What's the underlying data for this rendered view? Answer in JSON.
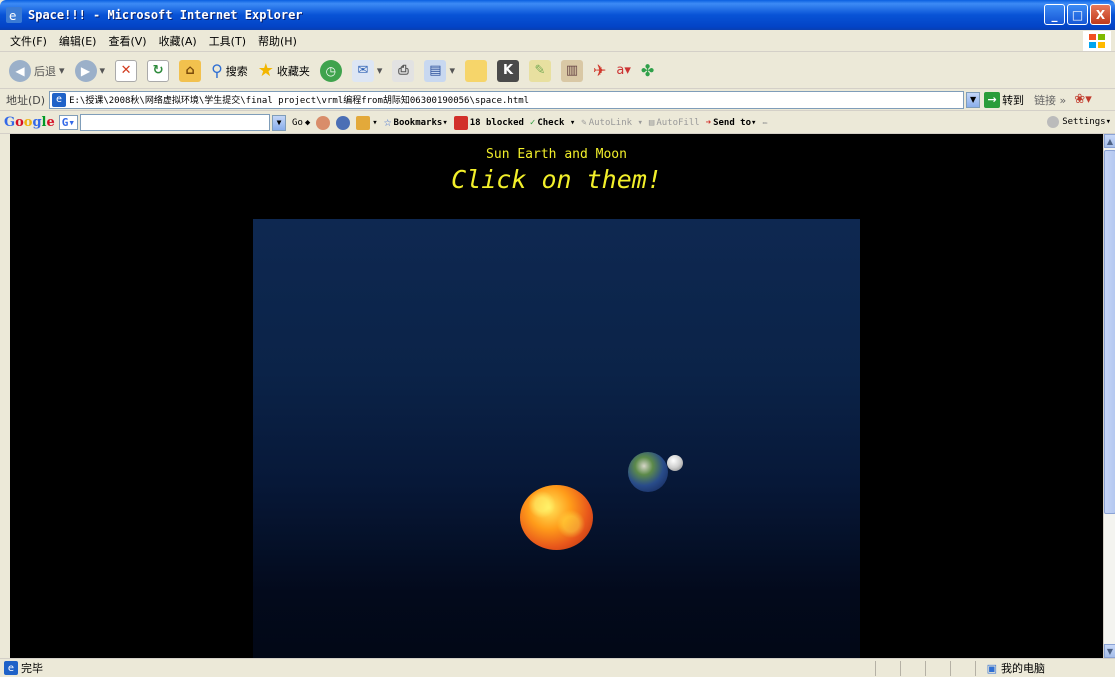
{
  "window": {
    "title": "Space!!! - Microsoft Internet Explorer",
    "buttons": [
      "_",
      "□",
      "X"
    ]
  },
  "menu": {
    "items": [
      "文件(F)",
      "编辑(E)",
      "查看(V)",
      "收藏(A)",
      "工具(T)",
      "帮助(H)"
    ]
  },
  "toolbar": {
    "back_label": "后退",
    "search_label": "搜索",
    "favorites_label": "收藏夹"
  },
  "address": {
    "label": "地址(D)",
    "url": "E:\\授课\\2008秋\\网络虚拟环境\\学生提交\\final project\\vrml编程from胡际知06300190056\\space.html",
    "go_label": "转到",
    "links_label": "链接"
  },
  "google_bar": {
    "logo": "Google",
    "go_label": "Go",
    "bookmarks_label": "Bookmarks▾",
    "blocked_label": "18 blocked",
    "check_label": "Check ▾",
    "autolink_label": "AutoLink ▾",
    "autofill_label": "AutoFill",
    "sendto_label": "Send to▾",
    "settings_label": "Settings▾"
  },
  "page": {
    "subtitle": "Sun Earth and Moon",
    "headline": "Click on them!"
  },
  "status": {
    "left": "完毕",
    "right": "我的电脑"
  },
  "colors": {
    "heading_yellow": "#F2EF2A",
    "xp_blue": "#0853D6",
    "sun_orange": "#FF9C1A"
  }
}
